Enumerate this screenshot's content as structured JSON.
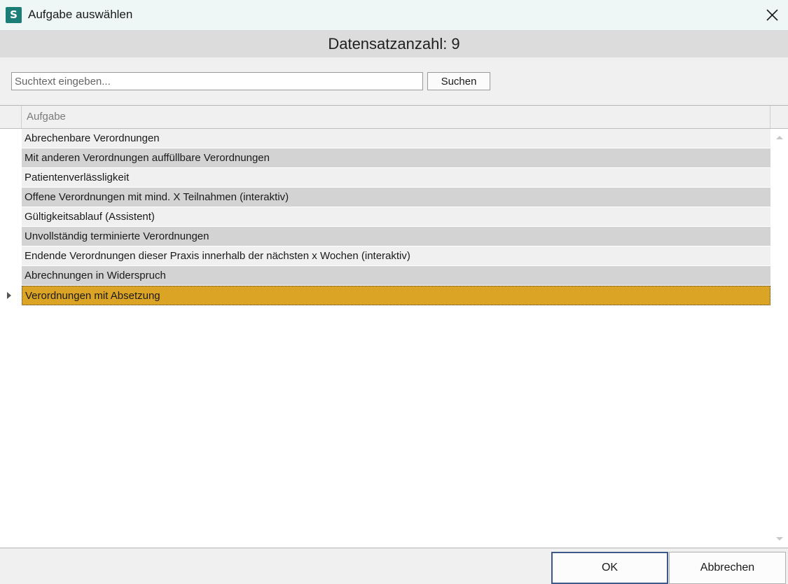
{
  "window": {
    "app_icon_letter": "S",
    "title": "Aufgabe auswählen",
    "close_icon": "close-icon"
  },
  "record_count_text": "Datensatzanzahl: 9",
  "search": {
    "placeholder": "Suchtext eingeben...",
    "value": "",
    "button_label": "Suchen"
  },
  "grid": {
    "column_header": "Aufgabe",
    "rows": [
      "Abrechenbare Verordnungen",
      "Mit anderen Verordnungen auffüllbare Verordnungen",
      "Patientenverlässligkeit",
      "Offene Verordnungen mit mind. X Teilnahmen (interaktiv)",
      "Gültigkeitsablauf (Assistent)",
      "Unvollständig terminierte Verordnungen",
      "Endende Verordnungen dieser Praxis innerhalb der nächsten x Wochen (interaktiv)",
      "Abrechnungen in Widerspruch",
      "Verordnungen mit Absetzung"
    ],
    "selected_index": 8
  },
  "footer": {
    "ok_label": "OK",
    "cancel_label": "Abbrechen"
  },
  "colors": {
    "app_icon": "#1a7d76",
    "titlebar": "#eef7f6",
    "selected_row": "#dca424",
    "alt_row": "#d3d3d3",
    "ok_border": "#3d5a8a"
  }
}
